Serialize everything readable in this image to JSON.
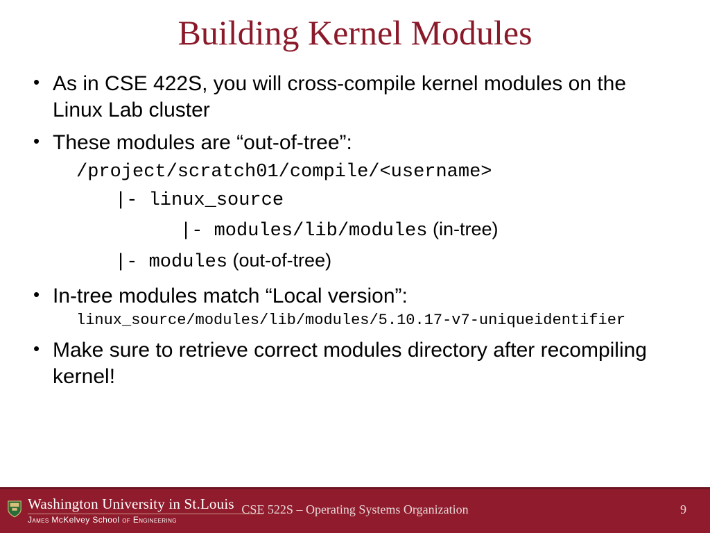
{
  "title": "Building Kernel Modules",
  "bullets": {
    "b1": "As in CSE 422S, you will cross-compile kernel modules on the Linux Lab cluster",
    "b2": "These modules are “out-of-tree”:",
    "path_root": "/project/scratch01/compile/<username>",
    "path_line1": "|- linux_source",
    "path_line2_mono": "|- modules/lib/modules",
    "path_line2_paren": " (in-tree)",
    "path_line3_mono": "|- modules",
    "path_line3_paren": " (out-of-tree)",
    "b3": "In-tree modules match “Local version”:",
    "b3_path": "linux_source/modules/lib/modules/5.10.17-v7-uniqueidentifier",
    "b4": "Make sure to retrieve correct modules directory after recompiling kernel!"
  },
  "footer": {
    "university": "Washington University in St.Louis",
    "school_prefix": "James ",
    "school_mid": "McKelvey School ",
    "school_suffix": "of Engineering",
    "course": "CSE 522S – Operating Systems Organization",
    "page": "9"
  }
}
